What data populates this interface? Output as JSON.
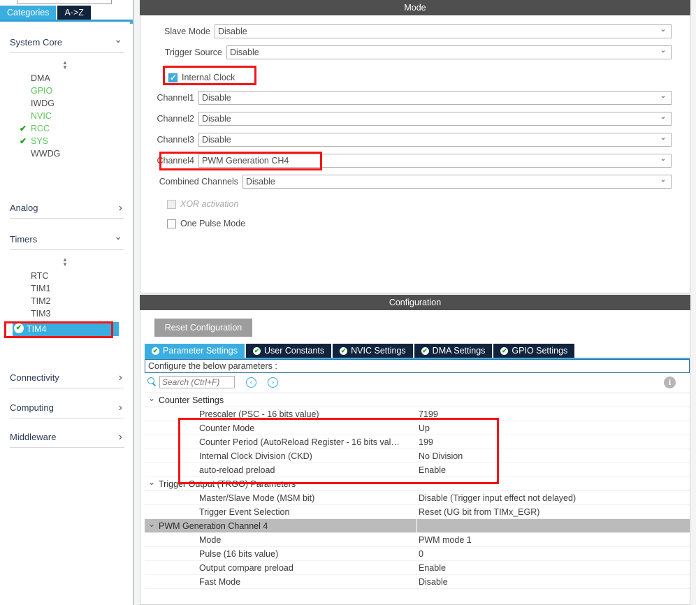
{
  "left_panel": {
    "search_placeholder": "",
    "tabs": [
      {
        "label": "Categories",
        "selected": true
      },
      {
        "label": "A->Z",
        "selected": false
      }
    ],
    "groups": [
      {
        "label": "System Core",
        "expanded": true,
        "items": [
          {
            "label": "DMA",
            "state": "plain"
          },
          {
            "label": "GPIO",
            "state": "configured"
          },
          {
            "label": "IWDG",
            "state": "plain"
          },
          {
            "label": "NVIC",
            "state": "configured"
          },
          {
            "label": "RCC",
            "state": "checked"
          },
          {
            "label": "SYS",
            "state": "checked"
          },
          {
            "label": "WWDG",
            "state": "plain"
          }
        ]
      },
      {
        "label": "Analog",
        "expanded": false,
        "items": []
      },
      {
        "label": "Timers",
        "expanded": true,
        "items": [
          {
            "label": "RTC",
            "state": "plain"
          },
          {
            "label": "TIM1",
            "state": "plain"
          },
          {
            "label": "TIM2",
            "state": "plain"
          },
          {
            "label": "TIM3",
            "state": "plain"
          },
          {
            "label": "TIM4",
            "state": "selected"
          }
        ]
      },
      {
        "label": "Connectivity",
        "expanded": false,
        "items": []
      },
      {
        "label": "Computing",
        "expanded": false,
        "items": []
      },
      {
        "label": "Middleware",
        "expanded": false,
        "items": []
      }
    ]
  },
  "mode": {
    "title": "Mode",
    "fields": [
      {
        "label": "Slave Mode",
        "value": "Disable"
      },
      {
        "label": "Trigger Source",
        "value": "Disable"
      },
      {
        "label": "Channel1",
        "value": "Disable"
      },
      {
        "label": "Channel2",
        "value": "Disable"
      },
      {
        "label": "Channel3",
        "value": "Disable"
      },
      {
        "label": "Channel4",
        "value": "PWM Generation CH4"
      },
      {
        "label": "Combined Channels",
        "value": "Disable"
      }
    ],
    "checkboxes": [
      {
        "label": "Internal Clock",
        "checked": true,
        "disabled": false
      },
      {
        "label": "XOR activation",
        "checked": false,
        "disabled": true
      },
      {
        "label": "One Pulse Mode",
        "checked": false,
        "disabled": false
      }
    ]
  },
  "configuration": {
    "title": "Configuration",
    "reset_label": "Reset Configuration",
    "tabs": [
      {
        "label": "Parameter Settings",
        "selected": true
      },
      {
        "label": "User Constants",
        "selected": false
      },
      {
        "label": "NVIC Settings",
        "selected": false
      },
      {
        "label": "DMA Settings",
        "selected": false
      },
      {
        "label": "GPIO Settings",
        "selected": false
      }
    ],
    "note": "Configure the below parameters :",
    "search_placeholder": "Search (Ctrl+F)",
    "nav_prev": "‹",
    "nav_next": "›",
    "info_glyph": "i",
    "tree": [
      {
        "group": "Counter Settings",
        "shaded": false,
        "rows": [
          {
            "name": "Prescaler (PSC - 16 bits value)",
            "value": "7199"
          },
          {
            "name": "Counter Mode",
            "value": "Up"
          },
          {
            "name": "Counter Period (AutoReload Register - 16 bits val…",
            "value": "199"
          },
          {
            "name": "Internal Clock Division (CKD)",
            "value": "No Division"
          },
          {
            "name": "auto-reload preload",
            "value": "Enable"
          }
        ]
      },
      {
        "group": "Trigger Output (TRGO) Parameters",
        "shaded": false,
        "rows": [
          {
            "name": "Master/Slave Mode (MSM bit)",
            "value": "Disable (Trigger input effect not delayed)"
          },
          {
            "name": "Trigger Event Selection",
            "value": "Reset (UG bit from TIMx_EGR)"
          }
        ]
      },
      {
        "group": "PWM Generation Channel 4",
        "shaded": true,
        "rows": [
          {
            "name": "Mode",
            "value": "PWM mode 1"
          },
          {
            "name": "Pulse (16 bits value)",
            "value": "0"
          },
          {
            "name": "Output compare preload",
            "value": "Enable"
          },
          {
            "name": "Fast Mode",
            "value": "Disable"
          }
        ]
      }
    ]
  },
  "colors": {
    "accent_blue": "#3aaee0",
    "tab_navy": "#11233d",
    "header_gray": "#4f4f4f",
    "annotation_red": "#f41414",
    "configured_green": "#5cc45c"
  }
}
